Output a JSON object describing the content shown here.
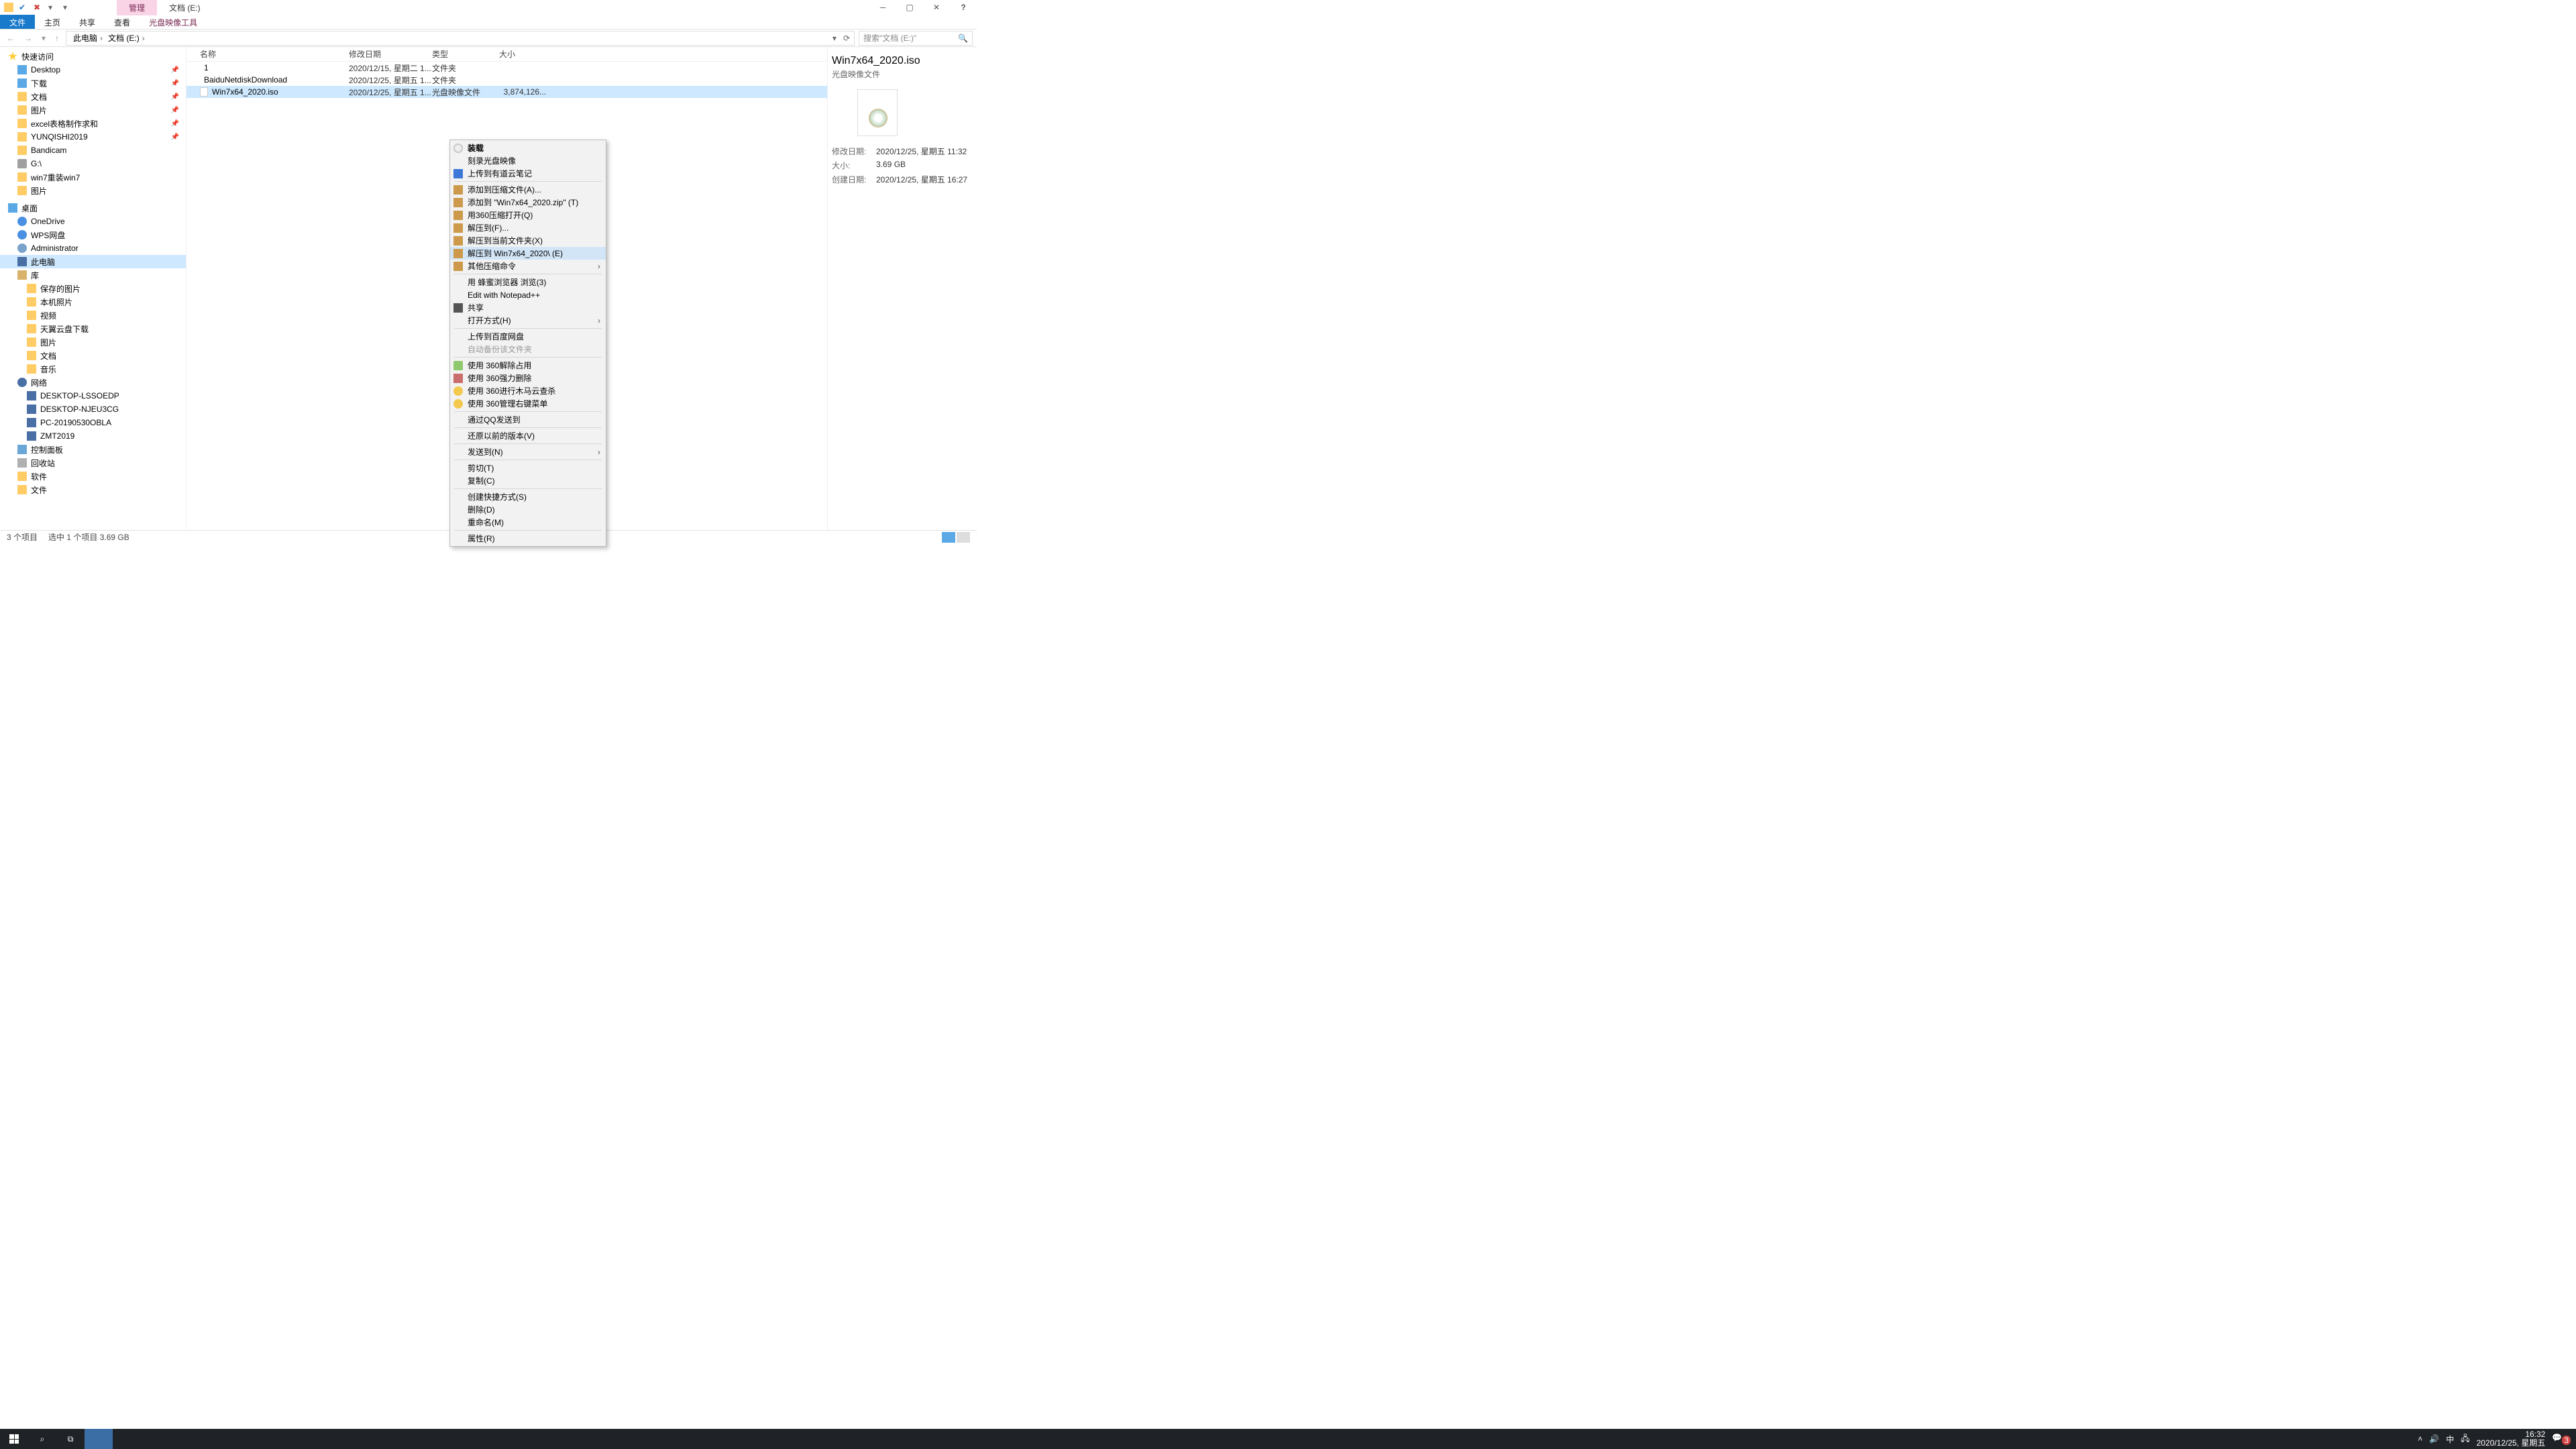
{
  "titlebar": {
    "manage": "管理",
    "title": "文档 (E:)"
  },
  "ribbon": {
    "file": "文件",
    "home": "主页",
    "share": "共享",
    "view": "查看",
    "tool": "光盘映像工具"
  },
  "address": {
    "root": "此电脑",
    "drive": "文档 (E:)",
    "search_placeholder": "搜索\"文档 (E:)\""
  },
  "columns": {
    "name": "名称",
    "date": "修改日期",
    "type": "类型",
    "size": "大小"
  },
  "tree": [
    {
      "t": "快速访问",
      "ico": "star",
      "d": 0
    },
    {
      "t": "Desktop",
      "ico": "desktop",
      "d": 1,
      "pin": true
    },
    {
      "t": "下载",
      "ico": "down",
      "d": 1,
      "pin": true
    },
    {
      "t": "文档",
      "ico": "folder",
      "d": 1,
      "pin": true
    },
    {
      "t": "图片",
      "ico": "folder",
      "d": 1,
      "pin": true
    },
    {
      "t": "excel表格制作求和",
      "ico": "folder",
      "d": 1,
      "pin": true
    },
    {
      "t": "YUNQISHI2019",
      "ico": "folder",
      "d": 1,
      "pin": true
    },
    {
      "t": "Bandicam",
      "ico": "folder",
      "d": 1
    },
    {
      "t": "G:\\",
      "ico": "drive",
      "d": 1
    },
    {
      "t": "win7重装win7",
      "ico": "folder",
      "d": 1
    },
    {
      "t": "图片",
      "ico": "folder",
      "d": 1
    },
    {
      "t": "桌面",
      "ico": "desktop",
      "d": 0
    },
    {
      "t": "OneDrive",
      "ico": "cloud",
      "d": 1
    },
    {
      "t": "WPS网盘",
      "ico": "cloud",
      "d": 1
    },
    {
      "t": "Administrator",
      "ico": "user",
      "d": 1
    },
    {
      "t": "此电脑",
      "ico": "pc",
      "d": 1,
      "sel": true
    },
    {
      "t": "库",
      "ico": "lib",
      "d": 1
    },
    {
      "t": "保存的图片",
      "ico": "folder",
      "d": 2
    },
    {
      "t": "本机照片",
      "ico": "folder",
      "d": 2
    },
    {
      "t": "视频",
      "ico": "folder",
      "d": 2
    },
    {
      "t": "天翼云盘下载",
      "ico": "folder",
      "d": 2
    },
    {
      "t": "图片",
      "ico": "folder",
      "d": 2
    },
    {
      "t": "文档",
      "ico": "folder",
      "d": 2
    },
    {
      "t": "音乐",
      "ico": "folder",
      "d": 2
    },
    {
      "t": "网络",
      "ico": "net",
      "d": 1
    },
    {
      "t": "DESKTOP-LSSOEDP",
      "ico": "pc",
      "d": 2
    },
    {
      "t": "DESKTOP-NJEU3CG",
      "ico": "pc",
      "d": 2
    },
    {
      "t": "PC-20190530OBLA",
      "ico": "pc",
      "d": 2
    },
    {
      "t": "ZMT2019",
      "ico": "pc",
      "d": 2
    },
    {
      "t": "控制面板",
      "ico": "panel",
      "d": 1
    },
    {
      "t": "回收站",
      "ico": "bin",
      "d": 1
    },
    {
      "t": "软件",
      "ico": "folder",
      "d": 1
    },
    {
      "t": "文件",
      "ico": "folder",
      "d": 1
    }
  ],
  "rows": [
    {
      "name": "1",
      "date": "2020/12/15, 星期二 1...",
      "type": "文件夹",
      "size": "",
      "ico": "folder"
    },
    {
      "name": "BaiduNetdiskDownload",
      "date": "2020/12/25, 星期五 1...",
      "type": "文件夹",
      "size": "",
      "ico": "folder"
    },
    {
      "name": "Win7x64_2020.iso",
      "date": "2020/12/25, 星期五 1...",
      "type": "光盘映像文件",
      "size": "3,874,126...",
      "ico": "file",
      "sel": true
    }
  ],
  "menu": [
    {
      "t": "装载",
      "ico": "disc",
      "bold": true
    },
    {
      "t": "刻录光盘映像"
    },
    {
      "t": "上传到有道云笔记",
      "ico": "note"
    },
    {
      "sep": true
    },
    {
      "t": "添加到压缩文件(A)...",
      "ico": "archive"
    },
    {
      "t": "添加到 \"Win7x64_2020.zip\" (T)",
      "ico": "archive"
    },
    {
      "t": "用360压缩打开(Q)",
      "ico": "archive"
    },
    {
      "t": "解压到(F)...",
      "ico": "archive"
    },
    {
      "t": "解压到当前文件夹(X)",
      "ico": "archive"
    },
    {
      "t": "解压到 Win7x64_2020\\ (E)",
      "ico": "archive",
      "hov": true
    },
    {
      "t": "其他压缩命令",
      "ico": "archive",
      "sub": true
    },
    {
      "sep": true
    },
    {
      "t": "用 蜂蜜浏览器 浏览(3)"
    },
    {
      "t": "Edit with Notepad++"
    },
    {
      "t": "共享",
      "ico": "share"
    },
    {
      "t": "打开方式(H)",
      "sub": true
    },
    {
      "sep": true
    },
    {
      "t": "上传到百度网盘"
    },
    {
      "t": "自动备份该文件夹",
      "disabled": true
    },
    {
      "sep": true
    },
    {
      "t": "使用 360解除占用",
      "ico": "shield"
    },
    {
      "t": "使用 360强力删除",
      "ico": "bin"
    },
    {
      "t": "使用 360进行木马云查杀",
      "ico": "shield-y"
    },
    {
      "t": "使用 360管理右键菜单",
      "ico": "shield-y"
    },
    {
      "sep": true
    },
    {
      "t": "通过QQ发送到"
    },
    {
      "sep": true
    },
    {
      "t": "还原以前的版本(V)"
    },
    {
      "sep": true
    },
    {
      "t": "发送到(N)",
      "sub": true
    },
    {
      "sep": true
    },
    {
      "t": "剪切(T)"
    },
    {
      "t": "复制(C)"
    },
    {
      "sep": true
    },
    {
      "t": "创建快捷方式(S)"
    },
    {
      "t": "删除(D)"
    },
    {
      "t": "重命名(M)"
    },
    {
      "sep": true
    },
    {
      "t": "属性(R)"
    }
  ],
  "details": {
    "name": "Win7x64_2020.iso",
    "type": "光盘映像文件",
    "kv": [
      {
        "k": "修改日期:",
        "v": "2020/12/25, 星期五 11:32"
      },
      {
        "k": "大小:",
        "v": "3.69 GB"
      },
      {
        "k": "创建日期:",
        "v": "2020/12/25, 星期五 16:27"
      }
    ]
  },
  "status": {
    "count": "3 个项目",
    "sel": "选中 1 个项目  3.69 GB"
  },
  "taskbar": {
    "time": "16:32",
    "date": "2020/12/25, 星期五",
    "ime": "中",
    "badge": "3"
  }
}
